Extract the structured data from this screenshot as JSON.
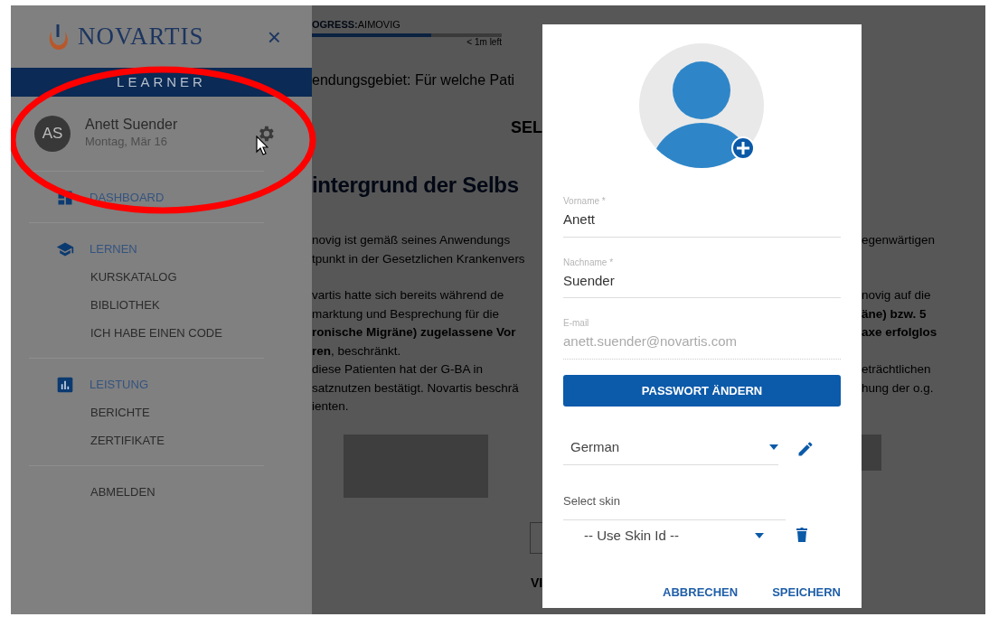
{
  "sidebar": {
    "logo_text": "NOVARTIS",
    "close_symbol": "×",
    "band": "LEARNER",
    "user": {
      "initials": "AS",
      "name": "Anett Suender",
      "date": "Montag, Mär 16"
    },
    "sections": [
      {
        "kind": "dashboard",
        "title": "DASHBOARD"
      },
      {
        "kind": "learn",
        "title": "LERNEN",
        "items": [
          "KURSKATALOG",
          "BIBLIOTHEK",
          "ICH HABE EINEN CODE"
        ]
      },
      {
        "kind": "performance",
        "title": "LEISTUNG",
        "items": [
          "BERICHTE",
          "ZERTIFIKATE"
        ]
      },
      {
        "kind": "plain",
        "title": "ABMELDEN"
      }
    ]
  },
  "main": {
    "progress": {
      "label": "OGRESS:",
      "course": "AIMOVIG",
      "level": 0.63,
      "remaining": "< 1m left"
    },
    "question": "endungsgebiet: Für welche Pati",
    "section_button": "SEL",
    "heading": "intergrund der Selbs",
    "paragraphs": [
      {
        "rows": [
          {
            "left": "novig ist gemäß seines Anwendungs",
            "right": "egenwärtigen"
          },
          {
            "left": "tpunkt in der Gesetzlichen Krankenvers"
          }
        ]
      },
      {
        "rows": [
          {
            "left": "vartis hatte sich bereits während de",
            "right": "novig auf die"
          },
          {
            "left": "marktung und Besprechung für die",
            "right": "**äne) bzw. 5**"
          },
          {
            "left": "**ronische Migräne) zugelassene Vor**",
            "right": "**axe erfolglos**"
          },
          {
            "left": "**ren**, beschränkt."
          },
          {
            "left": "diese Patienten hat der G-BA in",
            "right": "eträchtlichen"
          },
          {
            "left": "satznutzen bestätigt. Novartis beschrä",
            "right": "hung der o.g."
          },
          {
            "left": "ienten."
          }
        ]
      }
    ],
    "bottom_label": "VI"
  },
  "dialog": {
    "fields": [
      {
        "label": "Vorname *",
        "value": "Anett",
        "disabled": false
      },
      {
        "label": "Nachname *",
        "value": "Suender",
        "disabled": false
      },
      {
        "label": "E-mail",
        "value": "anett.suender@novartis.com",
        "disabled": true
      }
    ],
    "password_button": "PASSWORT ÄNDERN",
    "language": {
      "value": "German"
    },
    "skin": {
      "label": "Select skin",
      "value": "-- Use Skin Id --"
    },
    "actions": [
      "ABBRECHEN",
      "SPEICHERN"
    ]
  }
}
